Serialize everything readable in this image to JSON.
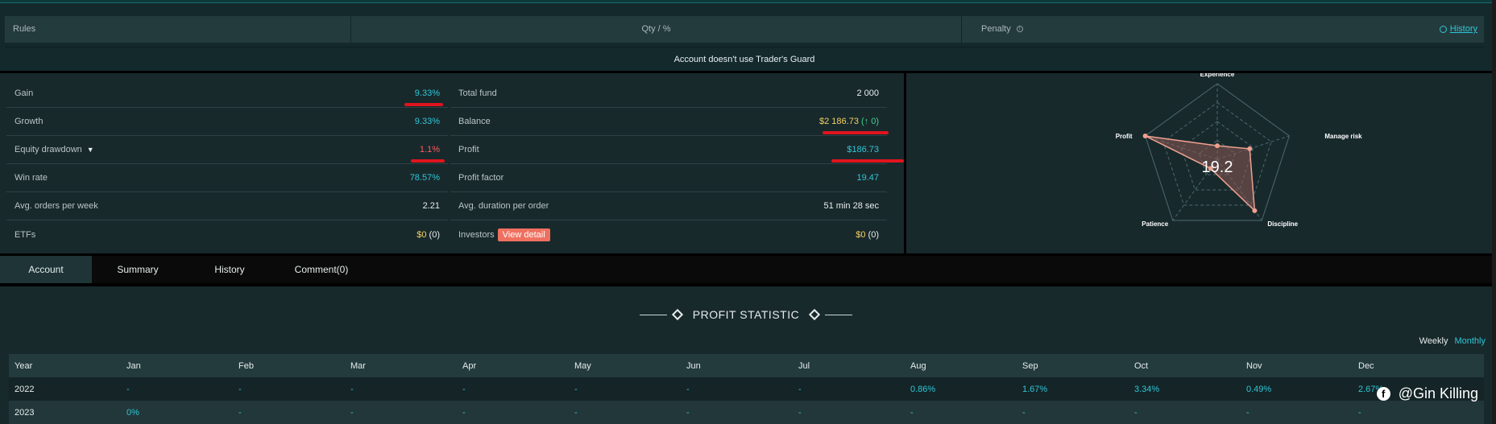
{
  "rules": {
    "col_rules": "Rules",
    "col_qty": "Qty / %",
    "col_penalty": "Penalty",
    "history_link": "History",
    "empty_message": "Account doesn't use Trader's Guard"
  },
  "stats": {
    "left": [
      {
        "label": "Gain",
        "value": "9.33%"
      },
      {
        "label": "Growth",
        "value": "9.33%"
      },
      {
        "label": "Equity drawdown",
        "value": "1.1%",
        "caret": "▼"
      },
      {
        "label": "Win rate",
        "value": "78.57%"
      },
      {
        "label": "Avg. orders per week",
        "value": "2.21"
      },
      {
        "label": "ETFs",
        "value_amount": "$0",
        "value_count": "(0)"
      }
    ],
    "right": [
      {
        "label": "Total fund",
        "value": "2 000"
      },
      {
        "label": "Balance",
        "value_amount": "$2 186.73",
        "value_change": "(↑ 0)"
      },
      {
        "label": "Profit",
        "value": "$186.73"
      },
      {
        "label": "Profit factor",
        "value": "19.47"
      },
      {
        "label": "Avg. duration per order",
        "value": "51 min 28 sec"
      },
      {
        "label": "Investors",
        "button": "View detail",
        "value_amount": "$0",
        "value_count": "(0)"
      }
    ]
  },
  "radar": {
    "score": "19.2",
    "axes": [
      "Experience",
      "Manage risk",
      "Discipline",
      "Patience",
      "Profit"
    ],
    "values": [
      0.18,
      0.45,
      0.84,
      0.15,
      1.0
    ],
    "colors": {
      "fill": "#8a5a55",
      "stroke": "#f0a090",
      "grid": "#4a6a6c"
    }
  },
  "tabs": [
    "Account",
    "Summary",
    "History",
    "Comment(0)"
  ],
  "profit_statistic": {
    "title": "PROFIT STATISTIC",
    "toggle": {
      "weekly": "Weekly",
      "monthly": "Monthly"
    },
    "headers": [
      "Year",
      "Jan",
      "Feb",
      "Mar",
      "Apr",
      "May",
      "Jun",
      "Jul",
      "Aug",
      "Sep",
      "Oct",
      "Nov",
      "Dec"
    ],
    "rows": [
      {
        "year": "2022",
        "values": [
          "-",
          "-",
          "-",
          "-",
          "-",
          "-",
          "-",
          "0.86%",
          "1.67%",
          "3.34%",
          "0.49%",
          "2.67%"
        ]
      },
      {
        "year": "2023",
        "values": [
          "0%",
          "-",
          "-",
          "-",
          "-",
          "-",
          "-",
          "-",
          "-",
          "-",
          "-",
          "-"
        ]
      }
    ]
  },
  "watermark": {
    "icon": "facebook-icon",
    "text": "@Gin Killing"
  }
}
